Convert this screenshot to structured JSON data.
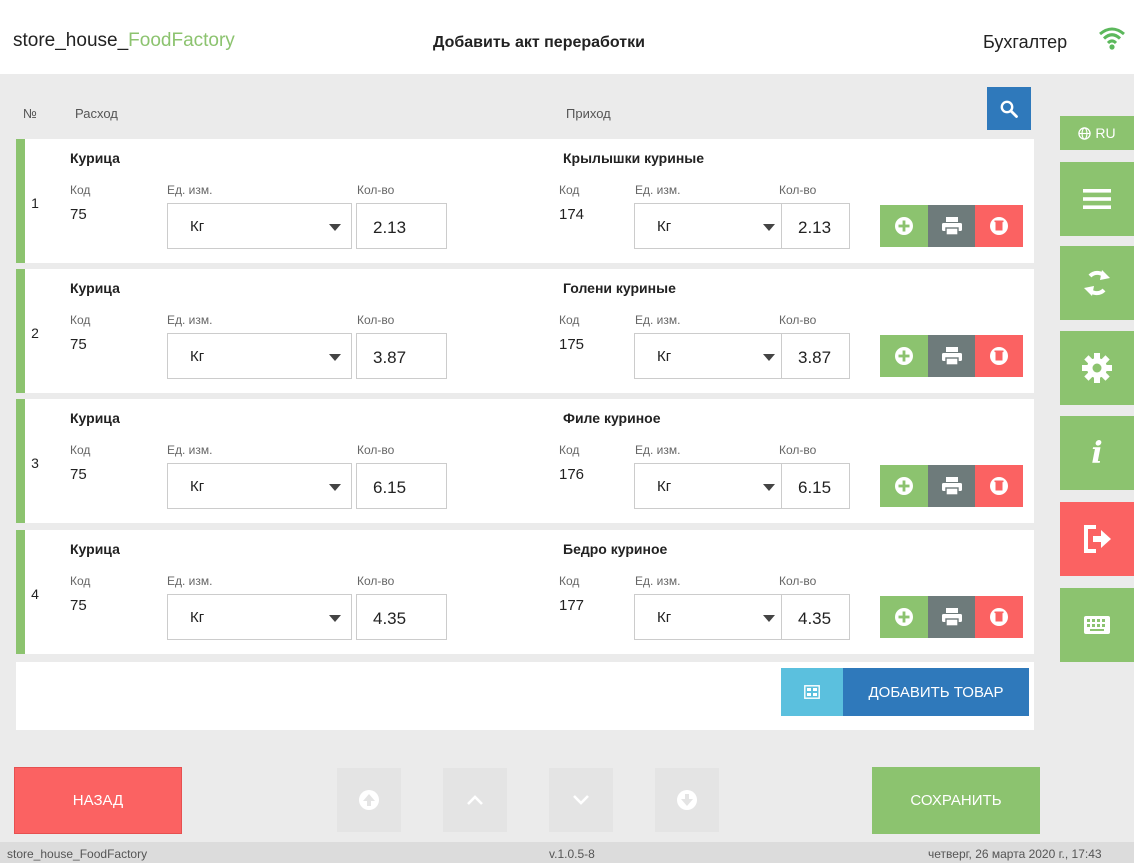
{
  "header": {
    "app_name_prefix": "store_house_",
    "app_name_brand": "FoodFactory",
    "page_title": "Добавить акт переработки",
    "user_role": "Бухгалтер"
  },
  "side": {
    "lang_label": "RU",
    "info_label": "i"
  },
  "columns": {
    "number": "№",
    "expense": "Расход",
    "income": "Приход",
    "code": "Код",
    "unit": "Ед. изм.",
    "qty": "Кол-во"
  },
  "rows": [
    {
      "n": "1",
      "out_name": "Курица",
      "out_code": "75",
      "out_unit": "Кг",
      "out_qty": "2.13",
      "in_name": "Крылышки куриные",
      "in_code": "174",
      "in_unit": "Кг",
      "in_qty": "2.13"
    },
    {
      "n": "2",
      "out_name": "Курица",
      "out_code": "75",
      "out_unit": "Кг",
      "out_qty": "3.87",
      "in_name": "Голени куриные",
      "in_code": "175",
      "in_unit": "Кг",
      "in_qty": "3.87"
    },
    {
      "n": "3",
      "out_name": "Курица",
      "out_code": "75",
      "out_unit": "Кг",
      "out_qty": "6.15",
      "in_name": "Филе куриное",
      "in_code": "176",
      "in_unit": "Кг",
      "in_qty": "6.15"
    },
    {
      "n": "4",
      "out_name": "Курица",
      "out_code": "75",
      "out_unit": "Кг",
      "out_qty": "4.35",
      "in_name": "Бедро куриное",
      "in_code": "177",
      "in_unit": "Кг",
      "in_qty": "4.35"
    }
  ],
  "actions": {
    "add_item": "ДОБАВИТЬ ТОВАР",
    "back": "НАЗАД",
    "save": "СОХРАНИТЬ"
  },
  "status": {
    "left": "store_house_FoodFactory",
    "version": "v.1.0.5-8",
    "datetime": "четверг, 26 марта 2020 г., 17:43"
  },
  "colors": {
    "green": "#8cc36f",
    "red": "#fb6262",
    "blue": "#2f79bb",
    "light_blue": "#5bc0de",
    "gray": "#6e7b7b"
  },
  "icons": [
    "wifi-icon",
    "search-icon",
    "globe-icon",
    "menu-icon",
    "sync-icon",
    "gear-icon",
    "info-icon",
    "logout-icon",
    "keyboard-icon",
    "plus-circle-icon",
    "print-icon",
    "trash-icon",
    "barcode-icon",
    "first-icon",
    "up-icon",
    "down-icon",
    "last-icon"
  ]
}
